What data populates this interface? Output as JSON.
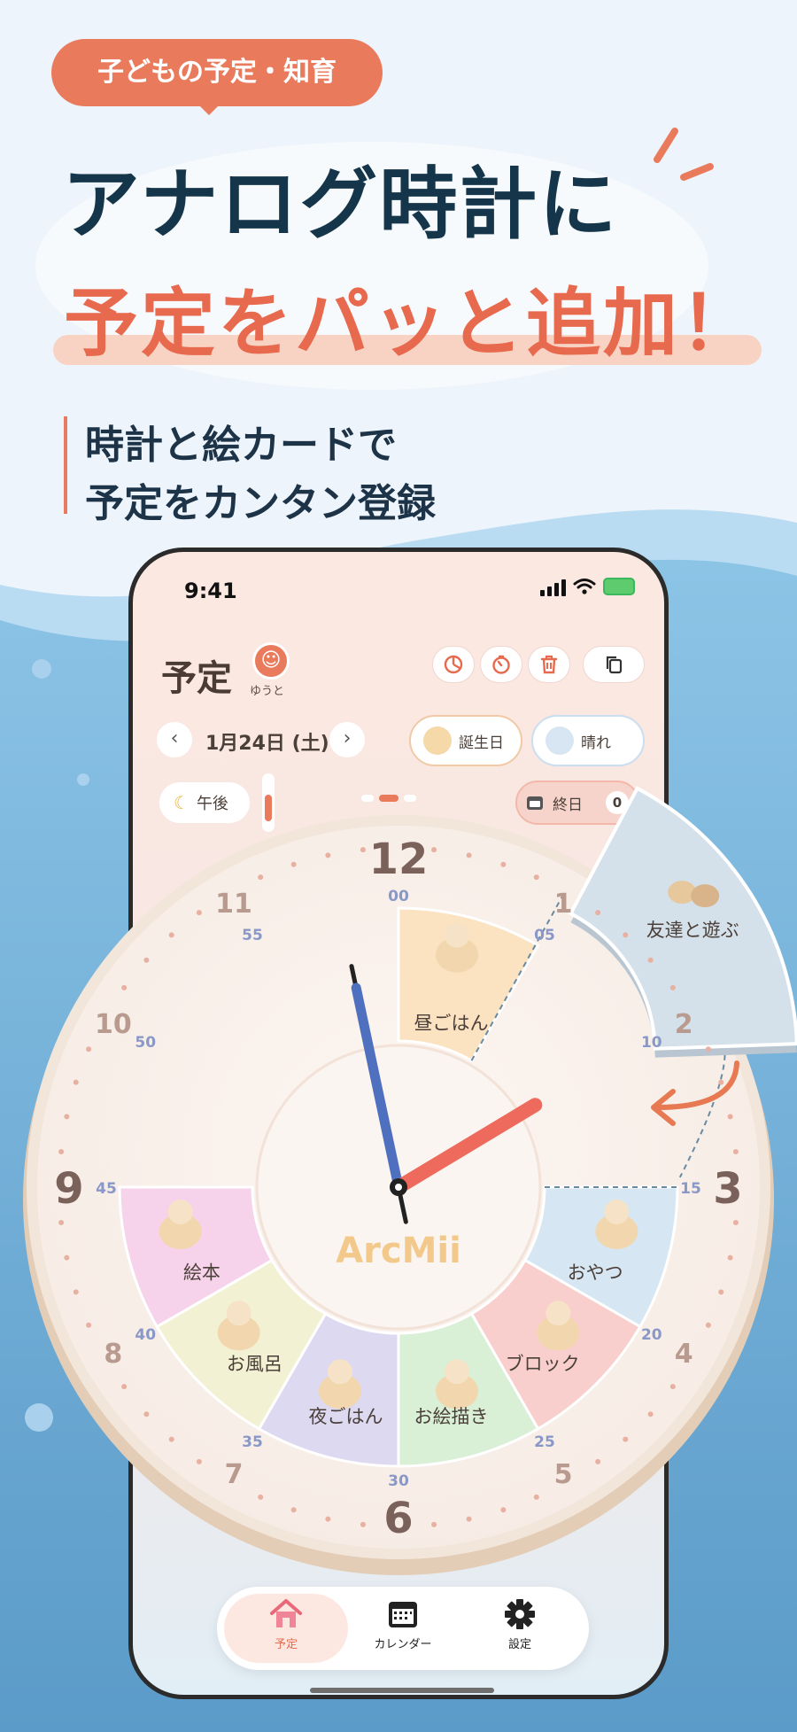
{
  "banner": {
    "tag": "子どもの予定・知育",
    "headline_line1": "アナログ時計に",
    "headline_line2": "予定をパッと追加！",
    "subtitle_line1": "時計と絵カードで",
    "subtitle_line2": "予定をカンタン登録"
  },
  "status_bar": {
    "time": "9:41"
  },
  "app": {
    "screen_title": "予定",
    "profile": {
      "name": "ゆうと",
      "icon": "smiley-face-icon"
    },
    "toolbar_icons": [
      "pie-chart-icon",
      "timer-icon",
      "trash-icon",
      "copy-icon"
    ],
    "date": "1月24日 (土)",
    "chips": {
      "birthday": "誕生日",
      "weather": "晴れ"
    },
    "period": "午後",
    "all_day": {
      "label": "終日",
      "count": "0"
    },
    "clock": {
      "hour_numbers": [
        "12",
        "1",
        "2",
        "3",
        "4",
        "5",
        "6",
        "7",
        "8",
        "9",
        "10",
        "11"
      ],
      "minute_labels": [
        "00",
        "05",
        "10",
        "15",
        "20",
        "25",
        "30",
        "35",
        "40",
        "45",
        "50",
        "55"
      ],
      "hands_time": "12:58",
      "logo": "ArcMii",
      "events": [
        {
          "label": "昼ごはん",
          "color": "#fbe2c0"
        },
        {
          "label": "おやつ",
          "color": "#d6e6f2"
        },
        {
          "label": "ブロック",
          "color": "#f8cfcc"
        },
        {
          "label": "お絵描き",
          "color": "#d9efd6"
        },
        {
          "label": "夜ごはん",
          "color": "#dcd9f0"
        },
        {
          "label": "お風呂",
          "color": "#f3f1d3"
        },
        {
          "label": "絵本",
          "color": "#f6d3ea"
        }
      ],
      "dragging_card": {
        "label": "友達と遊ぶ",
        "color": "#d5e1ea"
      }
    },
    "tabs": [
      {
        "label": "予定",
        "icon": "house-icon",
        "active": true
      },
      {
        "label": "カレンダー",
        "icon": "calendar-icon",
        "active": false
      },
      {
        "label": "設定",
        "icon": "gear-icon",
        "active": false
      }
    ]
  },
  "colors": {
    "accent": "#ea7a5c",
    "headline_dark": "#15354a",
    "minute_hand": "#4f6fbf",
    "hour_hand": "#ee6a5c"
  }
}
